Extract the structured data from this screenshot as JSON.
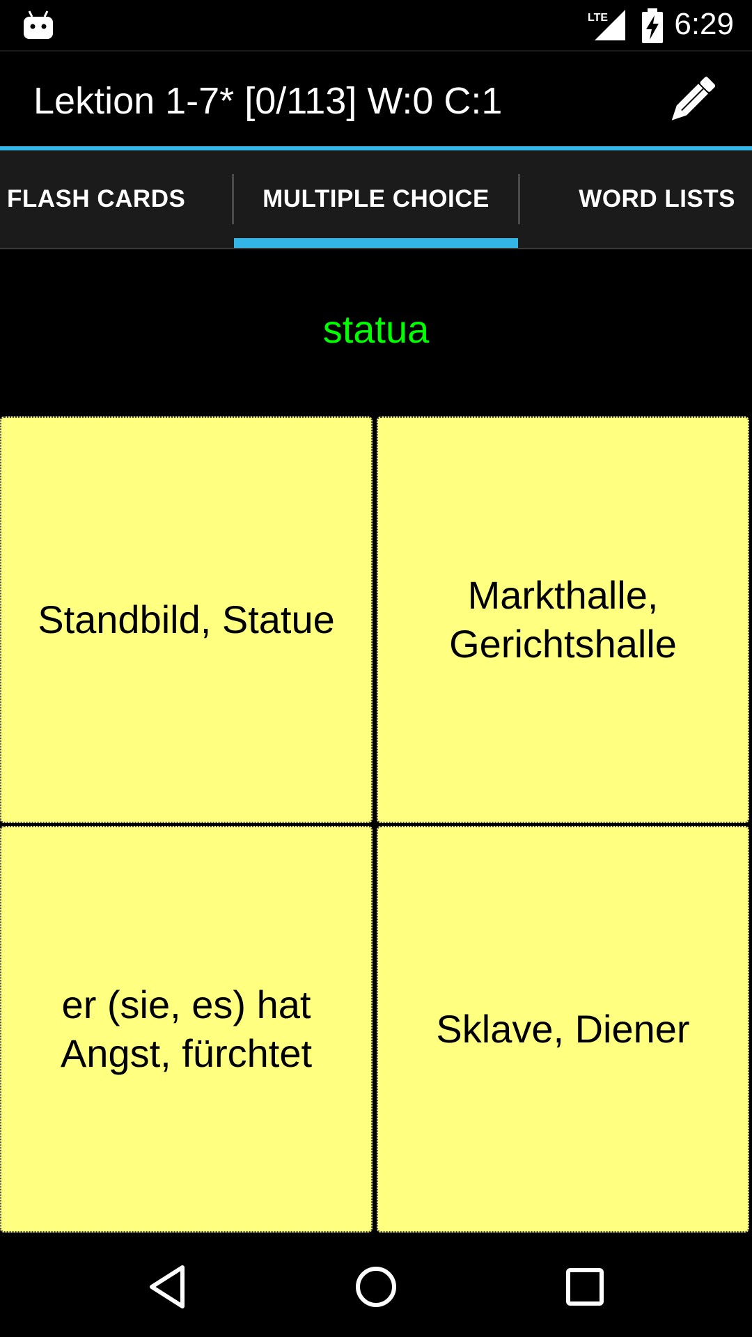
{
  "status_bar": {
    "time": "6:29",
    "network": "LTE",
    "icons": [
      "android-icon",
      "lte-signal-icon",
      "battery-charging-icon"
    ]
  },
  "action_bar": {
    "title": "Lektion 1-7* [0/113] W:0 C:1",
    "edit_icon": "pencil-icon"
  },
  "tabs": [
    {
      "label": "FLASH CARDS",
      "selected": false
    },
    {
      "label": "MULTIPLE CHOICE",
      "selected": true
    },
    {
      "label": "WORD LISTS",
      "selected": false
    }
  ],
  "question": {
    "word": "statua",
    "color": "#00ff00"
  },
  "choices": [
    {
      "text": "Standbild, Statue"
    },
    {
      "text": "Markthalle, Gerichtshalle"
    },
    {
      "text": "er (sie, es) hat Angst, fürchtet"
    },
    {
      "text": "Sklave, Diener"
    }
  ],
  "colors": {
    "accent": "#33b5e5",
    "choice_bg": "#ffff80",
    "tab_bg": "#1b1b1b"
  },
  "nav_bar": {
    "icons": [
      "back-icon",
      "home-icon",
      "recent-apps-icon"
    ]
  }
}
